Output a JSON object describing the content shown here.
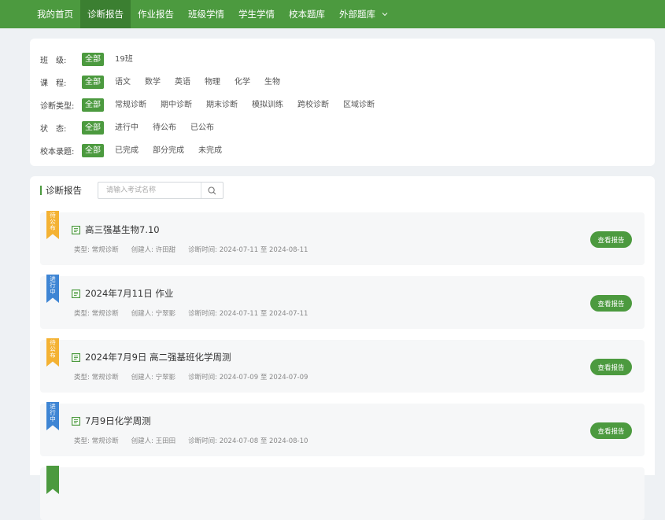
{
  "colors": {
    "brand_green": "#4c9a3f",
    "status_pending": "#f4b233",
    "status_in_progress": "#3e85d4"
  },
  "nav": {
    "items": [
      {
        "label": "我的首页"
      },
      {
        "label": "诊断报告"
      },
      {
        "label": "作业报告"
      },
      {
        "label": "班级学情"
      },
      {
        "label": "学生学情"
      },
      {
        "label": "校本题库"
      },
      {
        "label": "外部题库"
      }
    ],
    "active_index": 1,
    "dropdown_icon": "chevron-down-icon"
  },
  "filters": [
    {
      "label": "班　级:",
      "options": [
        "全部",
        "19班"
      ],
      "selected": 0
    },
    {
      "label": "课　程:",
      "options": [
        "全部",
        "语文",
        "数学",
        "英语",
        "物理",
        "化学",
        "生物"
      ],
      "selected": 0
    },
    {
      "label": "诊断类型:",
      "options": [
        "全部",
        "常规诊断",
        "期中诊断",
        "期末诊断",
        "模拟训练",
        "跨校诊断",
        "区域诊断"
      ],
      "selected": 0
    },
    {
      "label": "状　态:",
      "options": [
        "全部",
        "进行中",
        "待公布",
        "已公布"
      ],
      "selected": 0
    },
    {
      "label": "校本录题:",
      "options": [
        "全部",
        "已完成",
        "部分完成",
        "未完成"
      ],
      "selected": 0
    }
  ],
  "reports": {
    "title": "诊断报告",
    "search_placeholder": "请输入考试名称",
    "search_icon": "search-icon",
    "view_button_label": "查看报告",
    "items": [
      {
        "status": [
          "待",
          "公",
          "布"
        ],
        "status_type": "pending",
        "name": "高三强基生物7.10",
        "type": "类型: 常规诊断",
        "creator": "创建人: 许田甜",
        "period": "诊断时间: 2024-07-11 至 2024-08-11"
      },
      {
        "status": [
          "进",
          "行",
          "中"
        ],
        "status_type": "in_progress",
        "name": "2024年7月11日 作业",
        "type": "类型: 常规诊断",
        "creator": "创建人: 宁翠影",
        "period": "诊断时间: 2024-07-11 至 2024-07-11"
      },
      {
        "status": [
          "待",
          "公",
          "布"
        ],
        "status_type": "pending",
        "name": "2024年7月9日 高二强基班化学周测",
        "type": "类型: 常规诊断",
        "creator": "创建人: 宁翠影",
        "period": "诊断时间: 2024-07-09 至 2024-07-09"
      },
      {
        "status": [
          "进",
          "行",
          "中"
        ],
        "status_type": "in_progress",
        "name": "7月9日化学周测",
        "type": "类型: 常规诊断",
        "creator": "创建人: 王田田",
        "period": "诊断时间: 2024-07-08 至 2024-08-10"
      }
    ]
  }
}
